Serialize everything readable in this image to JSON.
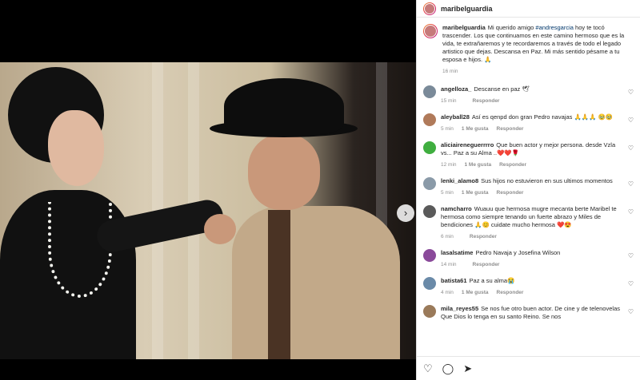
{
  "header": {
    "username": "maribelguardia"
  },
  "caption": {
    "username": "maribelguardia",
    "text_before": "Mi querido amigo ",
    "hashtag": "#andresgarcia",
    "text_after": " hoy te tocó trascender. Los que continuamos en este camino hermoso que es la vida, te extrañaremos y te recordaremos a través de todo el legado artistico que dejas. Descansa en Paz. Mi más sentido pésame a tu esposa e hijos. 🙏",
    "time": "16 min"
  },
  "comments": [
    {
      "username": "angelloza_",
      "text": "Descanse en paz 🕊",
      "time": "15 min",
      "likes": "",
      "reply": "Responder",
      "color": "#7a8a99"
    },
    {
      "username": "aleyball28",
      "text": "Así es qenpd don gran Pedro navajas 🙏🙏🙏 🥹🥹",
      "time": "5 min",
      "likes": "1 Me gusta",
      "reply": "Responder",
      "color": "#b07a5a"
    },
    {
      "username": "aliciaireneguerrrro",
      "text": "Que buen actor y mejor persona. desde Vzla vs... Paz a su Alma ..❤️❤️🌹",
      "time": "12 min",
      "likes": "1 Me gusta",
      "reply": "Responder",
      "color": "#3fae3f"
    },
    {
      "username": "lenki_alamo8",
      "text": "Sus hijos no estuvieron en sus ultimos momentos",
      "time": "5 min",
      "likes": "1 Me gusta",
      "reply": "Responder",
      "color": "#8a9aa8"
    },
    {
      "username": "namcharro",
      "text": "Wuauu que hermosa mugre mecanta berte Maribel te hermosa como siempre tenando un fuerte abrazo y Miles de bendiciones 🙏😊 cuidate mucho hermosa ❤️😍",
      "time": "6 min",
      "likes": "",
      "reply": "Responder",
      "color": "#5a5a5a"
    },
    {
      "username": "lasalsatime",
      "text": "Pedro Navaja y Josefina Wilson",
      "time": "14 min",
      "likes": "",
      "reply": "Responder",
      "color": "#8a4a9a"
    },
    {
      "username": "batista61",
      "text": "Paz a su alma😭",
      "time": "4 min",
      "likes": "1 Me gusta",
      "reply": "Responder",
      "color": "#6a8aa8"
    },
    {
      "username": "mila_reyes55",
      "text": "Se nos fue otro buen actor. De cine y de telenovelas Que Dios lo tenga en su santo Reino. Se nos",
      "time": "",
      "likes": "",
      "reply": "",
      "color": "#9a7a5a"
    }
  ],
  "icons": {
    "heart": "heart-icon",
    "comment": "comment-icon",
    "share": "share-icon",
    "save": "bookmark-icon",
    "next": "chevron-right-icon"
  }
}
